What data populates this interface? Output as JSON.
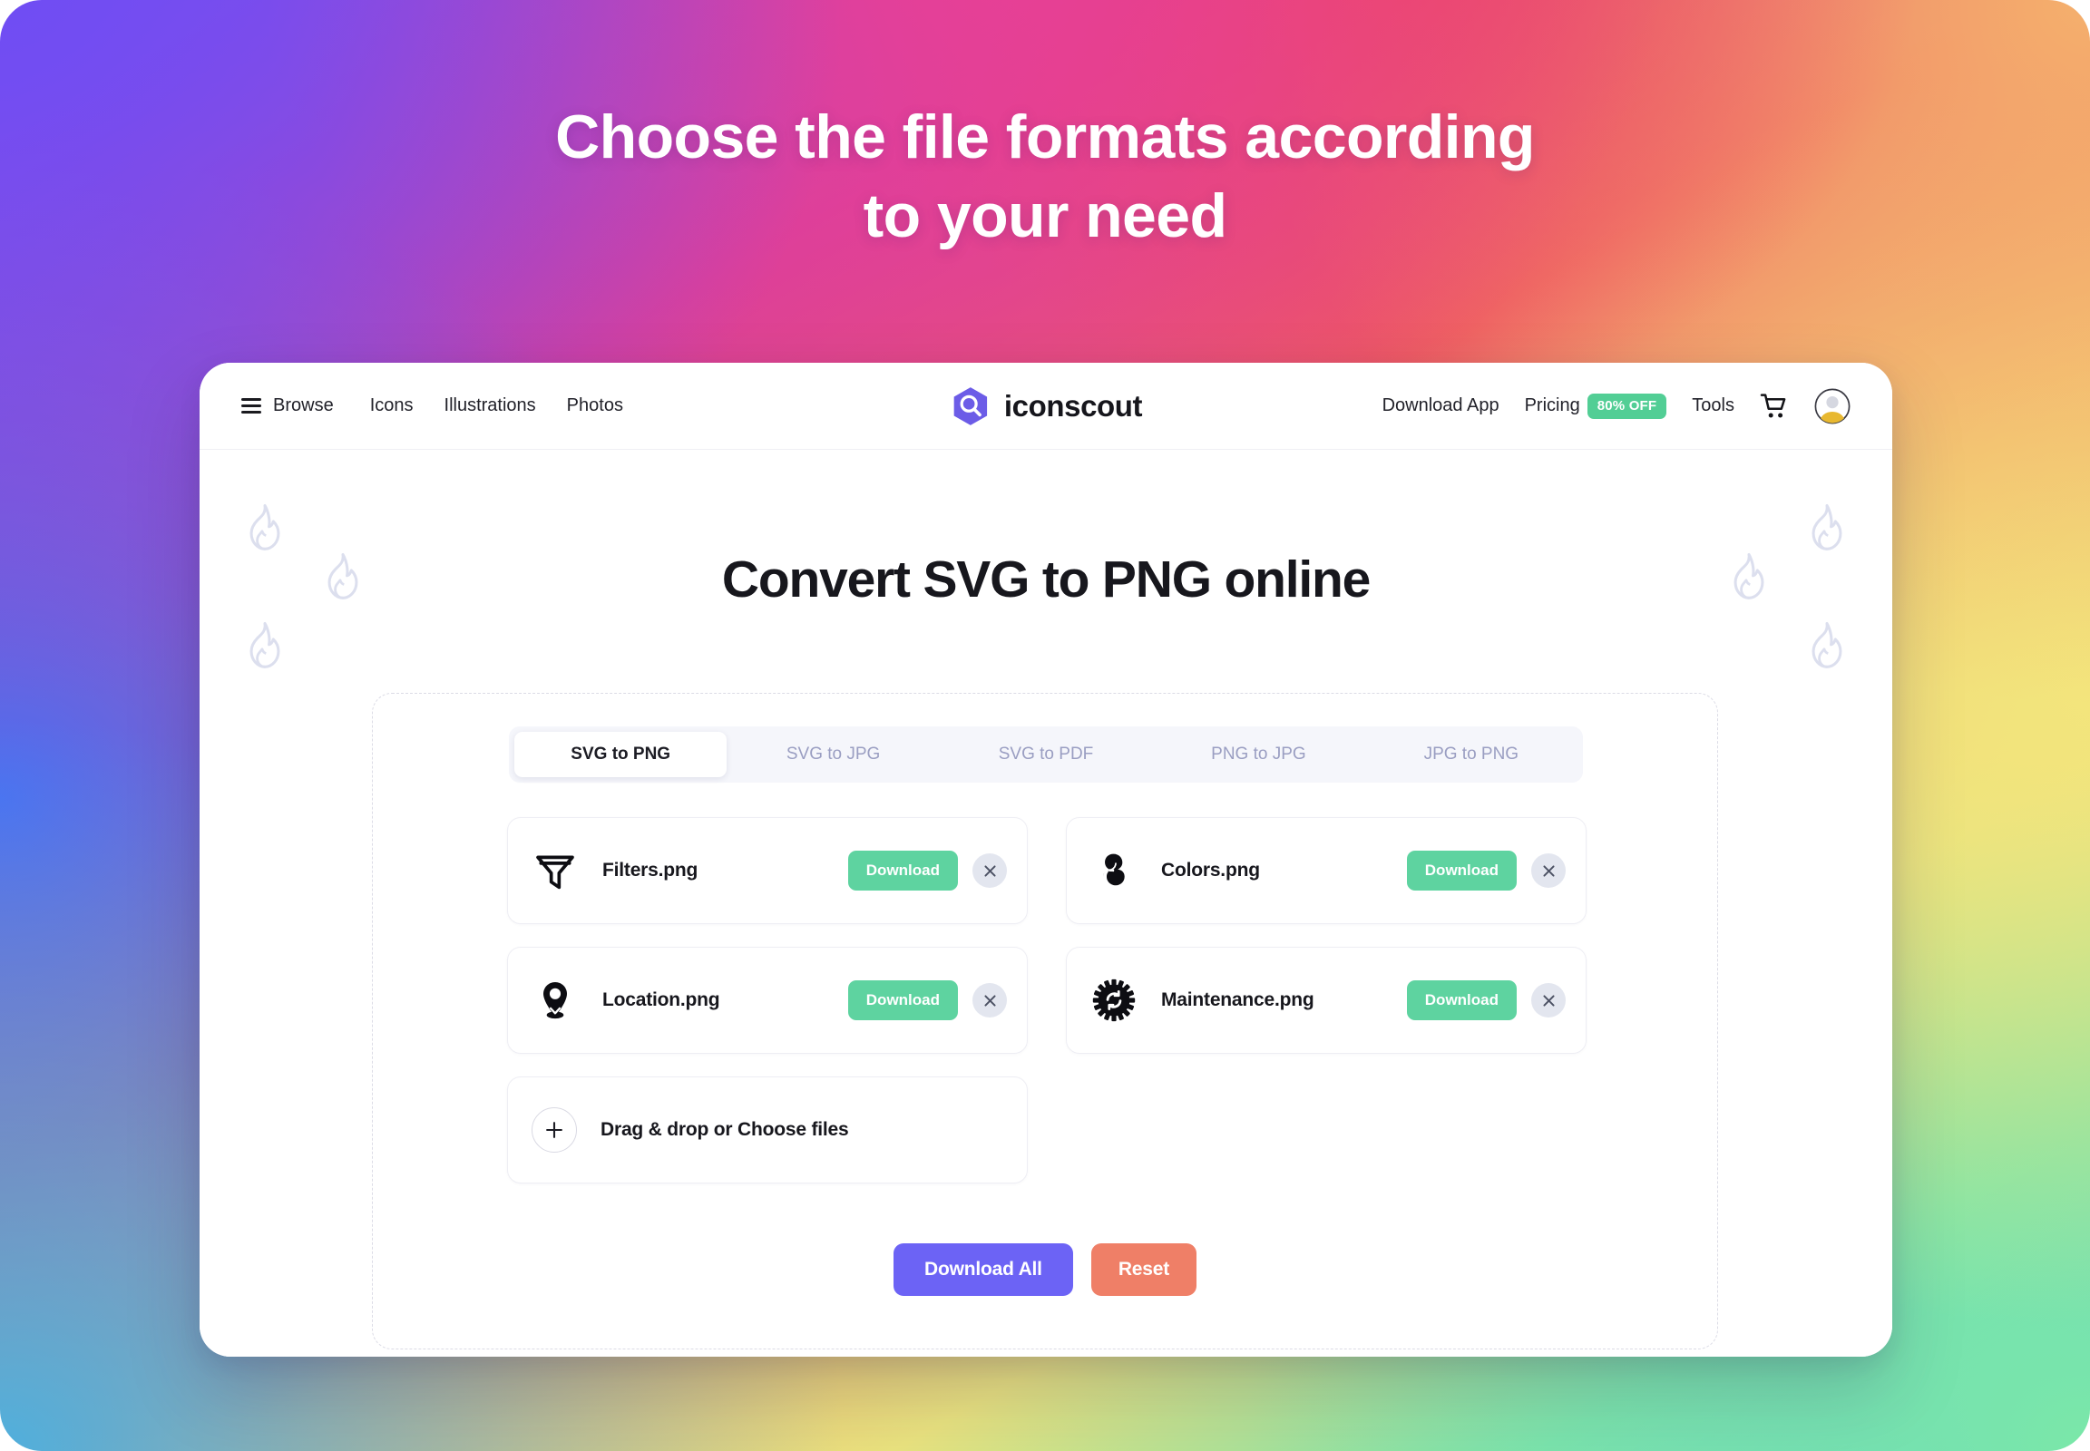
{
  "hero": {
    "headline_line1": "Choose the file formats according",
    "headline_line2": "to your need",
    "text_color": "#ffffff"
  },
  "nav": {
    "menu_icon": "hamburger-icon",
    "browse_label": "Browse",
    "links": [
      {
        "label": "Icons"
      },
      {
        "label": "Illustrations"
      },
      {
        "label": "Photos"
      }
    ],
    "logo": {
      "mark_icon": "iconscout-hexagon-search-logo",
      "text": "iconscout",
      "mark_color": "#6c5ce7"
    },
    "right": {
      "download_app_label": "Download App",
      "pricing_label": "Pricing",
      "offer_badge": "80% OFF",
      "offer_badge_color": "#52ce95",
      "tools_label": "Tools",
      "cart_icon": "shopping-cart-icon",
      "avatar_icon": "user-avatar-icon"
    }
  },
  "page": {
    "title": "Convert SVG to PNG online",
    "decoration_icon": "flame-icon",
    "decoration_color": "#dcdfee"
  },
  "converter": {
    "tabs": [
      {
        "label": "SVG to PNG",
        "active": true
      },
      {
        "label": "SVG to JPG",
        "active": false
      },
      {
        "label": "SVG to PDF",
        "active": false
      },
      {
        "label": "PNG to JPG",
        "active": false
      },
      {
        "label": "JPG to PNG",
        "active": false
      }
    ],
    "files": [
      {
        "name": "Filters.png",
        "icon": "funnel-filter-icon",
        "download_label": "Download",
        "remove_label": "×"
      },
      {
        "name": "Colors.png",
        "icon": "color-palette-blobs-icon",
        "download_label": "Download",
        "remove_label": "×"
      },
      {
        "name": "Location.png",
        "icon": "map-pin-location-icon",
        "download_label": "Download",
        "remove_label": "×"
      },
      {
        "name": "Maintenance.png",
        "icon": "gear-refresh-maintenance-icon",
        "download_label": "Download",
        "remove_label": "×"
      }
    ],
    "dropzone": {
      "icon": "plus-icon",
      "label": "Drag & drop or Choose files"
    },
    "actions": {
      "download_all_label": "Download All",
      "download_all_color": "#6c63f5",
      "reset_label": "Reset",
      "reset_color": "#ef7f67"
    },
    "download_button_color": "#5ed3a0"
  }
}
